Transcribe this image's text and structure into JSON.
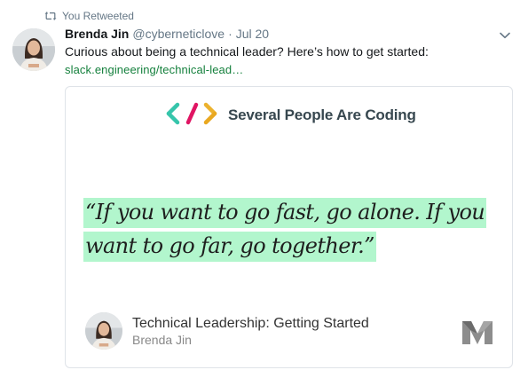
{
  "retweet": {
    "label": "You Retweeted",
    "icon": "retweet-icon"
  },
  "author": {
    "name": "Brenda Jin",
    "handle": "@cyberneticlove",
    "separator": "·",
    "date": "Jul 20"
  },
  "tweet": {
    "text": "Curious about being a technical leader? Here’s how to get started:",
    "link": "slack.engineering/technical-lead…"
  },
  "card": {
    "brand": "Several People Are Coding",
    "quote": "“If you want to go fast, go alone. If you want to go far, go together.”",
    "title": "Technical Leadership: Getting Started",
    "author": "Brenda Jin"
  },
  "colors": {
    "link": "#15803d",
    "highlight": "#b2f6cd",
    "muted": "#657786"
  },
  "icons": [
    "retweet-icon",
    "chevron-down-icon",
    "code-brackets-logo",
    "medium-logo"
  ]
}
